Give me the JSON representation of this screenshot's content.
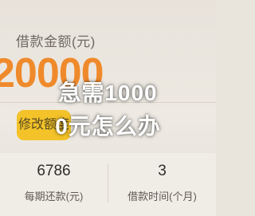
{
  "loan": {
    "amount_label": "借款金额(元)",
    "amount_value": "20000",
    "modify_label": "修改额度"
  },
  "overlay": {
    "title_line1": "急需1000",
    "title_line2": "0元怎么办"
  },
  "stats": {
    "monthly_repayment_value": "6786",
    "monthly_repayment_label": "每期还款(元)",
    "term_value": "3",
    "term_label": "借款时间(个月)"
  },
  "colors": {
    "accent_orange": "#ef8a2c",
    "button_yellow": "#f3c329"
  }
}
